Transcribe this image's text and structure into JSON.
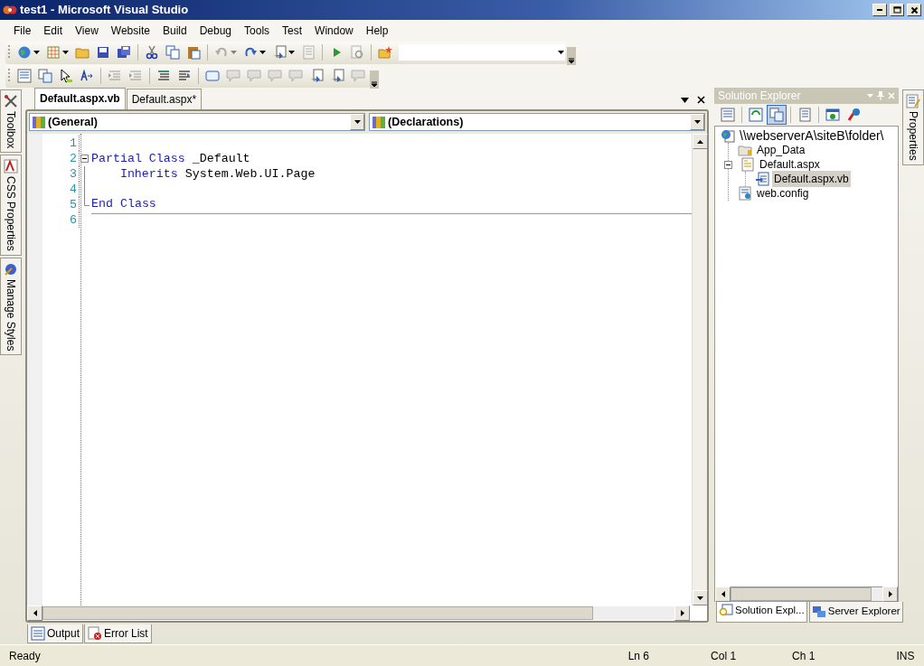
{
  "window": {
    "title": "test1 - Microsoft Visual Studio"
  },
  "menu": [
    "File",
    "Edit",
    "View",
    "Website",
    "Build",
    "Debug",
    "Tools",
    "Test",
    "Window",
    "Help"
  ],
  "toolbars": [
    {
      "items": [
        {
          "kind": "button",
          "disabled": false,
          "dropdown": true
        },
        {
          "kind": "button",
          "disabled": false,
          "dropdown": true
        },
        {
          "kind": "button",
          "disabled": false,
          "dropdown": false
        },
        {
          "kind": "button",
          "disabled": false,
          "dropdown": false
        },
        {
          "kind": "button",
          "disabled": false,
          "dropdown": false
        },
        {
          "kind": "separator"
        },
        {
          "kind": "button",
          "disabled": false,
          "dropdown": false
        },
        {
          "kind": "button",
          "disabled": false,
          "dropdown": false
        },
        {
          "kind": "button",
          "disabled": false,
          "dropdown": false
        },
        {
          "kind": "separator"
        },
        {
          "kind": "button",
          "disabled": true,
          "dropdown": true
        },
        {
          "kind": "button",
          "disabled": false,
          "dropdown": true
        },
        {
          "kind": "button",
          "disabled": false,
          "dropdown": true
        },
        {
          "kind": "button",
          "disabled": true,
          "dropdown": false
        },
        {
          "kind": "separator"
        },
        {
          "kind": "button",
          "disabled": false,
          "dropdown": false
        },
        {
          "kind": "button",
          "disabled": true,
          "dropdown": false
        },
        {
          "kind": "separator"
        },
        {
          "kind": "button",
          "disabled": false,
          "dropdown": false
        },
        {
          "kind": "combo"
        }
      ]
    },
    {
      "items": [
        {
          "kind": "button",
          "disabled": false,
          "dropdown": false
        },
        {
          "kind": "button",
          "disabled": false,
          "dropdown": false
        },
        {
          "kind": "button",
          "disabled": false,
          "dropdown": false
        },
        {
          "kind": "button",
          "disabled": false,
          "dropdown": false
        },
        {
          "kind": "separator"
        },
        {
          "kind": "button",
          "disabled": true,
          "dropdown": false
        },
        {
          "kind": "button",
          "disabled": true,
          "dropdown": false
        },
        {
          "kind": "separator"
        },
        {
          "kind": "button",
          "disabled": false,
          "dropdown": false
        },
        {
          "kind": "button",
          "disabled": false,
          "dropdown": false
        },
        {
          "kind": "separator"
        },
        {
          "kind": "button",
          "disabled": false,
          "dropdown": false
        },
        {
          "kind": "button",
          "disabled": true,
          "dropdown": false
        },
        {
          "kind": "button",
          "disabled": true,
          "dropdown": false
        },
        {
          "kind": "button",
          "disabled": true,
          "dropdown": false
        },
        {
          "kind": "button",
          "disabled": true,
          "dropdown": false
        },
        {
          "kind": "button",
          "disabled": false,
          "dropdown": false
        },
        {
          "kind": "button",
          "disabled": false,
          "dropdown": false
        },
        {
          "kind": "button",
          "disabled": true,
          "dropdown": false
        }
      ]
    }
  ],
  "left_side_tabs": [
    "Toolbox",
    "CSS Properties",
    "Manage Styles"
  ],
  "editor": {
    "tabs": [
      {
        "label": "Default.aspx.vb",
        "selected": true
      },
      {
        "label": "Default.aspx*",
        "selected": false
      }
    ],
    "class_combo": "(General)",
    "member_combo": "(Declarations)",
    "lines": [
      {
        "number": "1",
        "kind": "plain",
        "separator_below": false,
        "nested": false
      },
      {
        "number": "2",
        "kind": "open",
        "separator_below": false,
        "nested": false,
        "tokens": [
          {
            "text": "Partial",
            "kind": "keyword"
          },
          {
            "text": "Class",
            "kind": "keyword"
          },
          {
            "text": "_Default",
            "kind": "plain"
          }
        ]
      },
      {
        "number": "3",
        "kind": "inside",
        "separator_below": false,
        "nested": true,
        "tokens": [
          {
            "text": "Inherits",
            "kind": "keyword"
          },
          {
            "text": "System.Web.UI.Page",
            "kind": "plain"
          }
        ]
      },
      {
        "number": "4",
        "kind": "inside",
        "separator_below": false,
        "nested": false
      },
      {
        "number": "5",
        "kind": "close",
        "separator_below": true,
        "nested": false,
        "tokens": [
          {
            "text": "End",
            "kind": "keyword"
          },
          {
            "text": "Class",
            "kind": "keyword"
          }
        ]
      },
      {
        "number": "6",
        "kind": "plain",
        "separator_below": false,
        "nested": false
      }
    ]
  },
  "solution_explorer": {
    "title": "Solution Explorer",
    "toolbar": [
      {
        "pressed": false
      },
      {
        "pressed": false
      },
      {
        "pressed": true
      },
      {
        "pressed": false
      },
      {
        "pressed": false
      },
      {
        "pressed": false
      }
    ],
    "tree": [
      {
        "label": "\\\\webserverA\\siteB\\folder\\",
        "selected": false,
        "children": [
          {
            "label": "App_Data",
            "selected": false
          },
          {
            "label": "Default.aspx",
            "selected": false,
            "expanded": true,
            "children": [
              {
                "label": "Default.aspx.vb",
                "selected": true
              }
            ]
          },
          {
            "label": "web.config",
            "selected": false
          }
        ]
      }
    ],
    "bottom_tabs": [
      {
        "label": "Solution Expl...",
        "selected": true
      },
      {
        "label": "Server Explorer",
        "selected": false
      }
    ]
  },
  "right_side_tabs": [
    "Properties"
  ],
  "bottom_tabs": [
    "Output",
    "Error List"
  ],
  "status_bar": {
    "message": "Ready",
    "line": "Ln 6",
    "column": "Col 1",
    "char": "Ch 1",
    "mode": "INS"
  }
}
